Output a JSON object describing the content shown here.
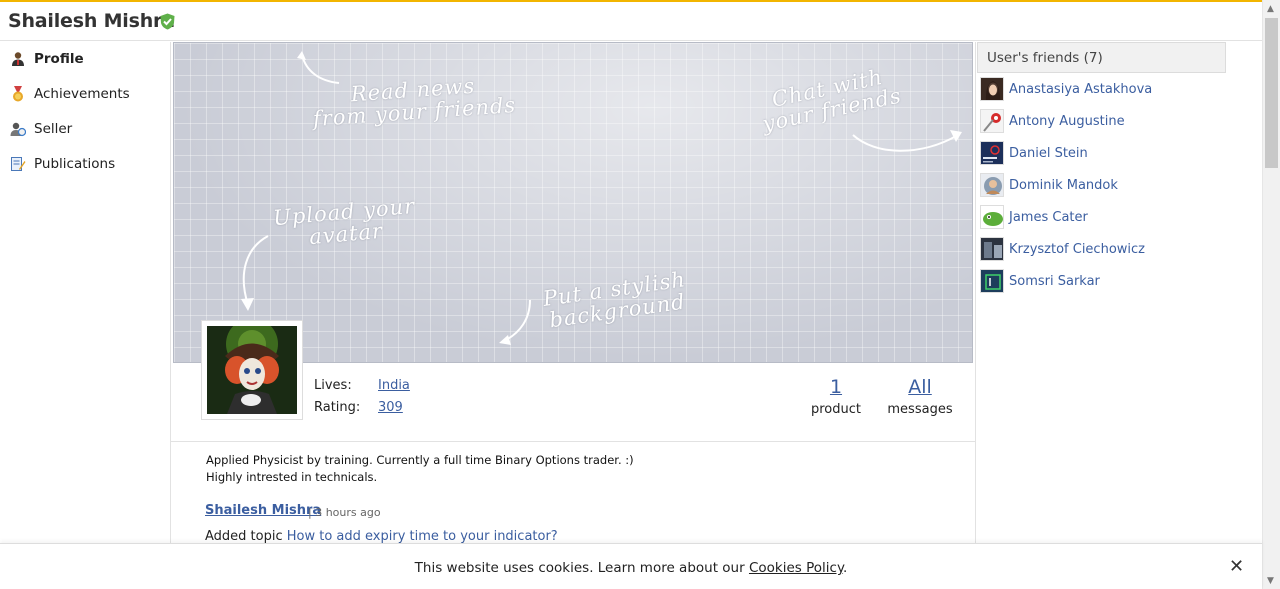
{
  "header": {
    "user_name": "Shailesh Mishra",
    "verified_icon": "verified-shield-icon",
    "accent_color": "#f2b500"
  },
  "sidebar": {
    "items": [
      {
        "label": "Profile",
        "icon": "user-icon",
        "active": true
      },
      {
        "label": "Achievements",
        "icon": "medal-icon",
        "active": false
      },
      {
        "label": "Seller",
        "icon": "seller-icon",
        "active": false
      },
      {
        "label": "Publications",
        "icon": "publication-icon",
        "active": false
      }
    ]
  },
  "cover": {
    "hints": {
      "news": "Read news\nfrom your friends",
      "chat": "Chat with\nyour friends",
      "avatar": "Upload your\navatar",
      "background": "Put a stylish\nbackground"
    }
  },
  "profile": {
    "lives_label": "Lives:",
    "lives_value": "India",
    "rating_label": "Rating:",
    "rating_value": "309",
    "stats": [
      {
        "value": "1",
        "label": "product"
      },
      {
        "value": "All",
        "label": "messages"
      }
    ]
  },
  "bio": {
    "line1": "Applied Physicist by training. Currently a full time Binary Options trader. :)",
    "line2": "Highly intrested in technicals."
  },
  "feed": {
    "author": "Shailesh Mishra",
    "time": "| 3 hours ago",
    "action_prefix": "Added topic ",
    "topic": "How to add expiry time to your indicator?"
  },
  "friends": {
    "title": "User's friends (7)",
    "list": [
      {
        "name": "Anastasiya Astakhova",
        "color": "#3a2a22"
      },
      {
        "name": "Antony Augustine",
        "color": "#d62b2b"
      },
      {
        "name": "Daniel Stein",
        "color": "#1c2f5a"
      },
      {
        "name": "Dominik Mandok",
        "color": "#8a9cb0"
      },
      {
        "name": "James Cater",
        "color": "#5cae3a"
      },
      {
        "name": "Krzysztof Ciechowicz",
        "color": "#2c3340"
      },
      {
        "name": "Somsri Sarkar",
        "color": "#1d3d5c"
      }
    ]
  },
  "cookie": {
    "text": "This website uses cookies. Learn more about our ",
    "link": "Cookies Policy",
    "suffix": ".",
    "close": "✕"
  },
  "colors": {
    "link": "#3b5ea0",
    "cover_bg": "#c9ccd6"
  }
}
